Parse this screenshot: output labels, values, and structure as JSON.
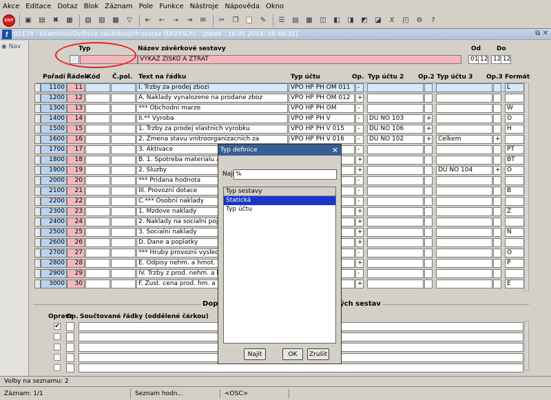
{
  "menu": [
    "Akce",
    "Editace",
    "Dotaz",
    "Blok",
    "Záznam",
    "Pole",
    "Funkce",
    "Nástroje",
    "Nápověda",
    "Okno"
  ],
  "toolbar": {
    "exit_label": "EXIT"
  },
  "window": {
    "title": "02178 - Účetnictví/Definice závěrkových sestav (EKVYSLR) - [pátek , 16.05.2014; 08:48:31]",
    "controls": "⧉ ✕"
  },
  "sidebar": {
    "nav_label": "Nav"
  },
  "header": {
    "typ_label": "Typ",
    "nazev_label": "Název závěrkové sestavy",
    "nazev_value": "VÝKAZ ZISKŮ A ZTRÁT",
    "od_label": "Od",
    "od_1": "01",
    "od_2": "12",
    "do_label": "Do",
    "do_1": "12",
    "do_2": "12"
  },
  "columns": {
    "poradi": "Pořadí",
    "radek": "Řádek",
    "kod": "Kód",
    "cpol": "Č.pol.",
    "text": "Text na řádku",
    "typ_uctu": "Typ účtu",
    "op": "Op.",
    "typ_uctu2": "Typ účtu 2",
    "op2": "Op.2",
    "typ_uctu3": "Typ účtu 3",
    "op3": "Op.3",
    "format": "Formát"
  },
  "rows": [
    {
      "poradi": "1100",
      "radek": "11",
      "text": "I.   Trzby za prodej zbozi",
      "typ": "VPO HP PH OM 011",
      "op": "-",
      "typ2": "",
      "op2": "",
      "typ3": "",
      "op3": "",
      "format": "L"
    },
    {
      "poradi": "1200",
      "radek": "12",
      "text": "A.   Naklady vynalozene na prodane zboz",
      "typ": "VPO HP PH OM 012",
      "op": "+",
      "typ2": "",
      "op2": "",
      "typ3": "",
      "op3": "",
      "format": ""
    },
    {
      "poradi": "1300",
      "radek": "13",
      "text": "*** Obchodni marze",
      "typ": "VPO HP PH OM",
      "op": "-",
      "typ2": "",
      "op2": "",
      "typ3": "",
      "op3": "",
      "format": "W"
    },
    {
      "poradi": "1400",
      "radek": "14",
      "text": "II.** Vyroba",
      "typ": "VPO HP PH V",
      "op": "-",
      "typ2": "DU NO 103",
      "op2": "+",
      "typ3": "",
      "op3": "",
      "format": "O"
    },
    {
      "poradi": "1500",
      "radek": "15",
      "text": "1. Trzby za prodej vlastnich vyrobku",
      "typ": "VPO HP PH V 015",
      "op": "-",
      "typ2": "DU NO 106",
      "op2": "+",
      "typ3": "",
      "op3": "",
      "format": "H"
    },
    {
      "poradi": "1600",
      "radek": "16",
      "text": "2. Zmena stavu vnitroorganizacnich za",
      "typ": "VPO HP PH V 016",
      "op": "-",
      "typ2": "DU NO 102",
      "op2": "+",
      "typ3": "Celkem",
      "op3": "+",
      "format": ""
    },
    {
      "poradi": "1700",
      "radek": "17",
      "text": "3. Aktivace",
      "typ": "",
      "op": "-",
      "typ2": "",
      "op2": "",
      "typ3": "",
      "op3": "",
      "format": "PT"
    },
    {
      "poradi": "1800",
      "radek": "18",
      "text": "B. 1. Spotreba materialu a ene",
      "typ": "",
      "op": "+",
      "typ2": "",
      "op2": "",
      "typ3": "",
      "op3": "",
      "format": "BT"
    },
    {
      "poradi": "1900",
      "radek": "19",
      "text": "2. Sluzby",
      "typ": "",
      "op": "+",
      "typ2": "",
      "op2": "",
      "typ3": "DU NO 104",
      "op3": "+",
      "format": "O"
    },
    {
      "poradi": "2000",
      "radek": "20",
      "text": "*** Pridana hodnota",
      "typ": "",
      "op": "-",
      "typ2": "",
      "op2": "",
      "typ3": "",
      "op3": "",
      "format": ""
    },
    {
      "poradi": "2100",
      "radek": "21",
      "text": "III. Provozni dotace",
      "typ": "",
      "op": "-",
      "typ2": "",
      "op2": "",
      "typ3": "",
      "op3": "",
      "format": "B"
    },
    {
      "poradi": "2200",
      "radek": "22",
      "text": "C.*** Osobni naklady",
      "typ": "",
      "op": "-",
      "typ2": "",
      "op2": "",
      "typ3": "",
      "op3": "",
      "format": ""
    },
    {
      "poradi": "2300",
      "radek": "23",
      "text": "1. Mzdove naklady",
      "typ": "",
      "op": "+",
      "typ2": "",
      "op2": "",
      "typ3": "",
      "op3": "",
      "format": "Z"
    },
    {
      "poradi": "2400",
      "radek": "24",
      "text": "2. Naklady na socialni pojiste",
      "typ": "",
      "op": "+",
      "typ2": "",
      "op2": "",
      "typ3": "",
      "op3": "",
      "format": ""
    },
    {
      "poradi": "2500",
      "radek": "25",
      "text": "3. Socialni naklady",
      "typ": "",
      "op": "+",
      "typ2": "",
      "op2": "",
      "typ3": "",
      "op3": "",
      "format": "N"
    },
    {
      "poradi": "2600",
      "radek": "26",
      "text": "D.   Dane a poplatky",
      "typ": "",
      "op": "+",
      "typ2": "",
      "op2": "",
      "typ3": "",
      "op3": "",
      "format": ""
    },
    {
      "poradi": "2700",
      "radek": "27",
      "text": "*** Hruby provozni vysledek",
      "typ": "",
      "op": "-",
      "typ2": "",
      "op2": "",
      "typ3": "",
      "op3": "",
      "format": "O"
    },
    {
      "poradi": "2800",
      "radek": "28",
      "text": "E.   Odpisy nehm. a hmot. inv",
      "typ": "",
      "op": "+",
      "typ2": "",
      "op2": "",
      "typ3": "",
      "op3": "",
      "format": "P"
    },
    {
      "poradi": "2900",
      "radek": "29",
      "text": "IV.  Trzby z prod. nehm. a hm",
      "typ": "",
      "op": "-",
      "typ2": "",
      "op2": "",
      "typ3": "",
      "op3": "",
      "format": ""
    },
    {
      "poradi": "3000",
      "radek": "30",
      "text": "F.   Zust. cena prod. hm. a ne",
      "typ": "",
      "op": "+",
      "typ2": "",
      "op2": "",
      "typ3": "",
      "op3": "",
      "format": "E"
    }
  ],
  "lower": {
    "title_left": "Dopl",
    "title_right": "ných sestav",
    "opr_label": "Oprava",
    "op_label": "Op.",
    "sum_label": "Součtované řádky (oddělené čárkou)",
    "first_checked": "✔"
  },
  "dialog": {
    "title": "Typ definice",
    "find_label": "Najít",
    "find_value": "%",
    "list_header": "Typ sestavy",
    "items": [
      "Statická",
      "Typ účtu"
    ],
    "btn_find": "Najít",
    "btn_ok": "OK",
    "btn_cancel": "Zrušit"
  },
  "status": {
    "line1": "Volby na seznamu: 2",
    "record": "Záznam: 1/1",
    "list": "Seznam hodn...",
    "osc": "<OSC>"
  }
}
